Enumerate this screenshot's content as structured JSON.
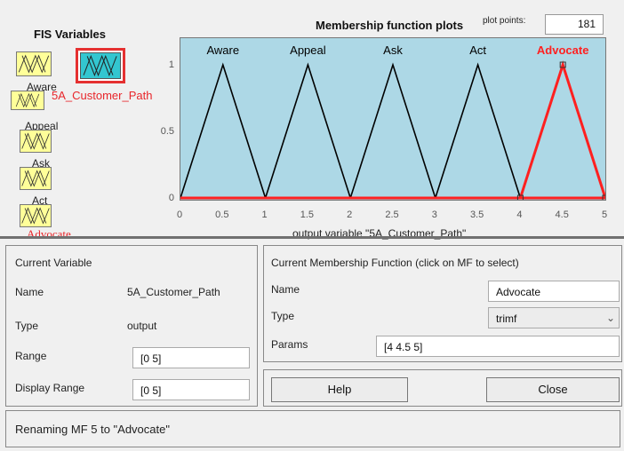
{
  "fis_panel": {
    "title": "FIS Variables",
    "inputs": [
      {
        "label": "Aware"
      },
      {
        "label": "Appeal"
      },
      {
        "label": "Ask"
      },
      {
        "label": "Act"
      }
    ],
    "output": {
      "label": "5A_Customer_Path"
    },
    "extra_label": "Advocate"
  },
  "plot": {
    "title": "Membership function plots",
    "points_label": "plot points:",
    "points_value": "181",
    "xlabel": "output variable \"5A_Customer_Path\"",
    "xticks": [
      "0",
      "0.5",
      "1",
      "1.5",
      "2",
      "2.5",
      "3",
      "3.5",
      "4",
      "4.5",
      "5"
    ],
    "yticks": [
      "0",
      "0.5",
      "1"
    ],
    "xlim": [
      0,
      5
    ],
    "ylim": [
      0,
      1
    ],
    "colors": {
      "background": "#add8e6",
      "normal": "#000000",
      "selected": "#ff2020",
      "label_normal": "#000000",
      "label_selected": "#ff2020"
    }
  },
  "chart_data": {
    "type": "line",
    "title": "Membership function plots",
    "xlabel": "output variable \"5A_Customer_Path\"",
    "ylabel": "",
    "xlim": [
      0,
      5
    ],
    "ylim": [
      0,
      1
    ],
    "series": [
      {
        "name": "Aware",
        "x": [
          0,
          0.5,
          1
        ],
        "y": [
          0,
          1,
          0
        ],
        "selected": false
      },
      {
        "name": "Appeal",
        "x": [
          1,
          1.5,
          2
        ],
        "y": [
          0,
          1,
          0
        ],
        "selected": false
      },
      {
        "name": "Ask",
        "x": [
          2,
          2.5,
          3
        ],
        "y": [
          0,
          1,
          0
        ],
        "selected": false
      },
      {
        "name": "Act",
        "x": [
          3,
          3.5,
          4
        ],
        "y": [
          0,
          1,
          0
        ],
        "selected": false
      },
      {
        "name": "Advocate",
        "x": [
          4,
          4.5,
          5
        ],
        "y": [
          0,
          1,
          0
        ],
        "selected": true
      }
    ]
  },
  "current_variable": {
    "title": "Current Variable",
    "name_label": "Name",
    "name_value": "5A_Customer_Path",
    "type_label": "Type",
    "type_value": "output",
    "range_label": "Range",
    "range_value": "[0 5]",
    "display_range_label": "Display Range",
    "display_range_value": "[0 5]"
  },
  "current_mf": {
    "title": "Current Membership Function (click on MF to select)",
    "name_label": "Name",
    "name_value": "Advocate",
    "type_label": "Type",
    "type_value": "trimf",
    "params_label": "Params",
    "params_value": "[4 4.5 5]"
  },
  "buttons": {
    "help": "Help",
    "close": "Close"
  },
  "status": "Renaming MF 5 to \"Advocate\""
}
